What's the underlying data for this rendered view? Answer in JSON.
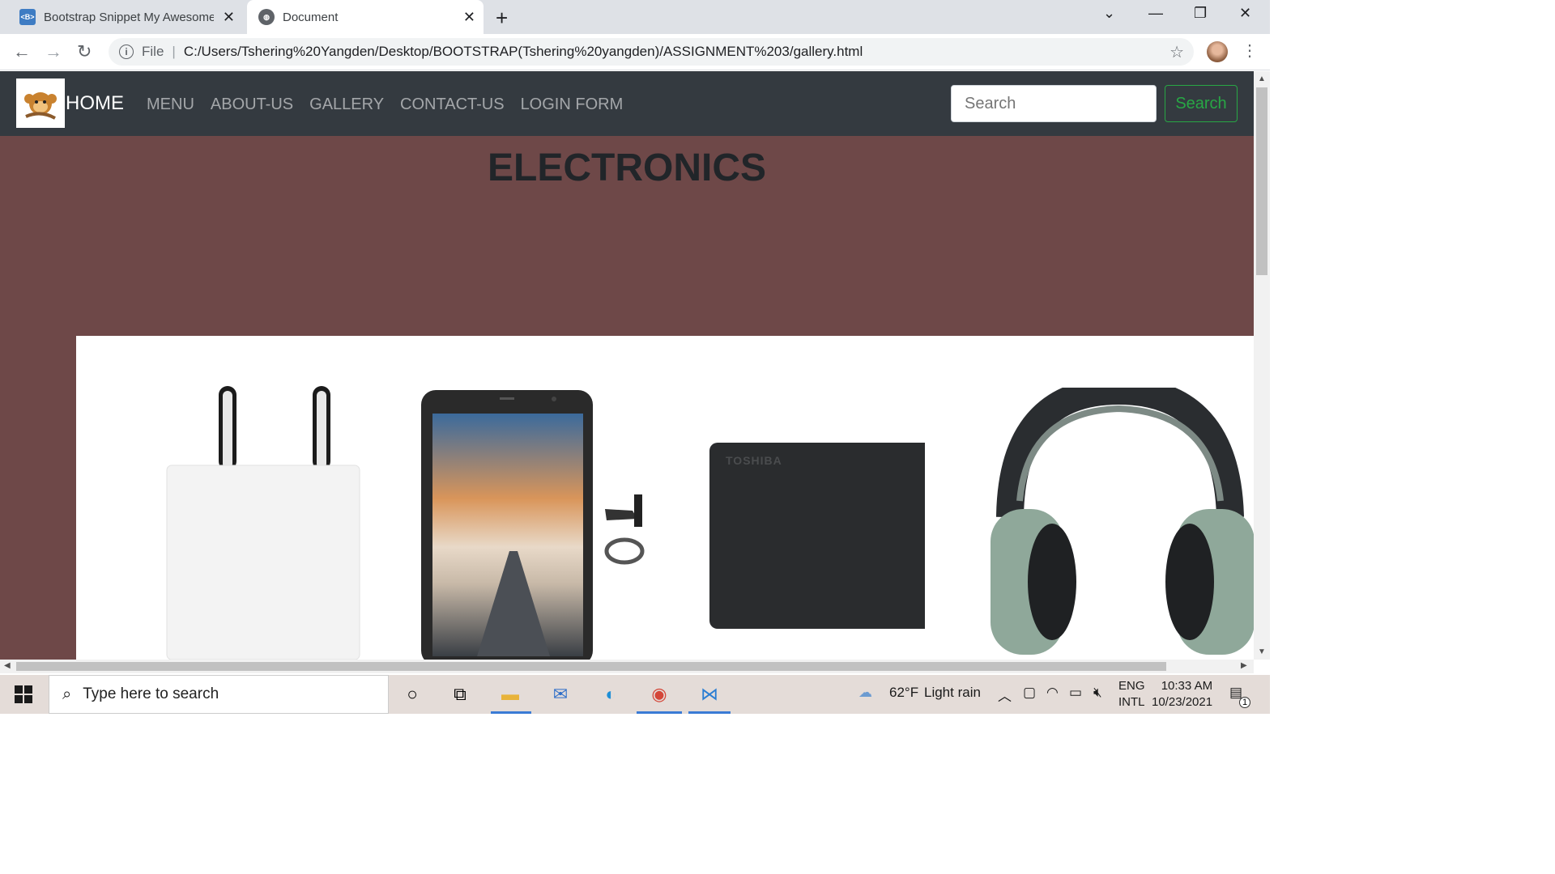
{
  "browser": {
    "tabs": [
      {
        "title": "Bootstrap Snippet My Awesome",
        "favicon": "bootstrap-favicon"
      },
      {
        "title": "Document",
        "favicon": "globe-icon"
      }
    ],
    "address": {
      "scheme_label": "File",
      "url": "C:/Users/Tshering%20Yangden/Desktop/BOOTSTRAP(Tshering%20yangden)/ASSIGNMENT%203/gallery.html"
    }
  },
  "page": {
    "navbar": {
      "brand": "HOME",
      "links": [
        "MENU",
        "ABOUT-US",
        "GALLERY",
        "CONTACT-US",
        "LOGIN FORM"
      ],
      "search_placeholder": "Search",
      "search_button": "Search"
    },
    "heading": "ELECTRONICS",
    "products": [
      {
        "name": "charger-adapter"
      },
      {
        "name": "smartphone"
      },
      {
        "name": "toshiba-hard-drive",
        "brand_text": "TOSHIBA"
      },
      {
        "name": "headphones"
      }
    ],
    "colors": {
      "navbar": "#343a40",
      "hero": "#6e4848",
      "search_button": "#28a745"
    }
  },
  "taskbar": {
    "search_placeholder": "Type here to search",
    "weather": {
      "temp": "62°F",
      "condition": "Light rain"
    },
    "lang": {
      "line1": "ENG",
      "line2": "INTL"
    },
    "time": "10:33 AM",
    "date": "10/23/2021",
    "notifications": "1"
  }
}
